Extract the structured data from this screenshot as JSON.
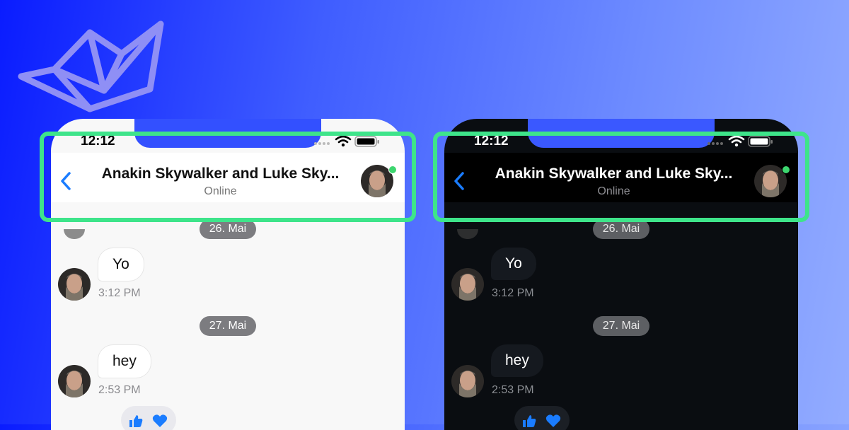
{
  "status": {
    "time": "12:12"
  },
  "header": {
    "title": "Anakin Skywalker and Luke Sky...",
    "subtitle": "Online"
  },
  "messages": [
    {
      "date": "26. Mai",
      "text": "Yo",
      "time": "3:12 PM"
    },
    {
      "date": "27. Mai",
      "text": "hey",
      "time": "2:53 PM"
    }
  ],
  "colors": {
    "accent": "#1a7cff",
    "online": "#3dd66f",
    "highlight": "#3ee48a",
    "light_background": "#f8f8f8",
    "dark_background": "#0a0d11"
  },
  "icons": [
    "boat-logo-icon",
    "wifi-icon",
    "battery-icon",
    "signal-icon",
    "back-chevron-icon",
    "avatar",
    "thumbs-up-icon",
    "heart-icon"
  ]
}
